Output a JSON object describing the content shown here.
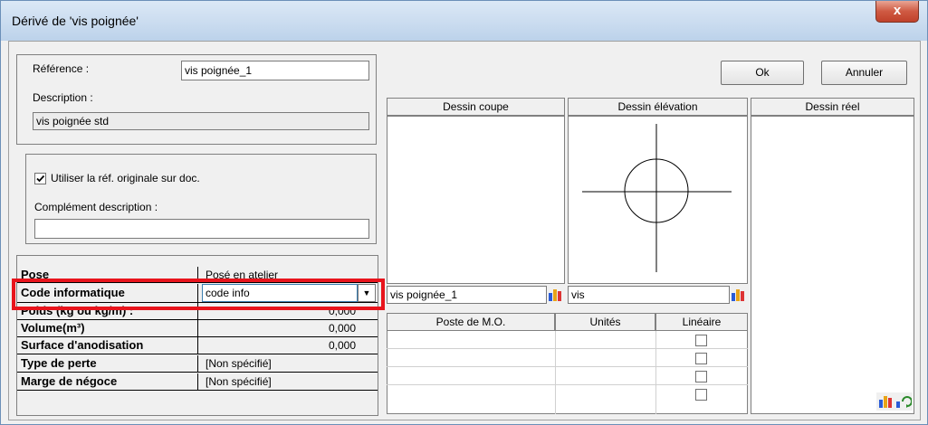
{
  "window": {
    "title": "Dérivé de 'vis poignée'",
    "close_glyph": "x"
  },
  "buttons": {
    "ok": "Ok",
    "cancel": "Annuler"
  },
  "header": {
    "reference_label": "Référence :",
    "reference_value": "vis poignée_1",
    "description_label": "Description :",
    "description_value": "vis poignée std"
  },
  "options": {
    "use_original_ref_label": "Utiliser la réf. originale sur doc.",
    "use_original_ref_checked": true,
    "complement_label": "Complément description :",
    "complement_value": ""
  },
  "properties": [
    {
      "label": "Pose",
      "value": "Posé en atelier"
    },
    {
      "label": "Code informatique",
      "value": "code info"
    },
    {
      "label": "Poids (kg ou kg/m) :",
      "value": "0,000"
    },
    {
      "label": "Volume(m³)",
      "value": "0,000"
    },
    {
      "label": "Surface d'anodisation",
      "value": "0,000"
    },
    {
      "label": "Type de perte",
      "value": "[Non spécifié]"
    },
    {
      "label": "Marge de négoce",
      "value": "[Non spécifié]"
    }
  ],
  "drawings": {
    "coupe_title": "Dessin coupe",
    "elevation_title": "Dessin élévation",
    "reel_title": "Dessin réel",
    "coupe_name": "vis poignée_1",
    "elevation_name": "vis"
  },
  "labor_table": {
    "headers": [
      "Poste de M.O.",
      "Unités",
      "Linéaire"
    ],
    "rows": 4
  },
  "colors": {
    "highlight": "#e8141c",
    "title_bg": "#c9dbef",
    "close_bg": "#c84a33"
  },
  "icons": [
    "close-icon",
    "checkbox-checked-icon",
    "dropdown-arrow-icon",
    "chart-icon",
    "refresh-icon"
  ]
}
